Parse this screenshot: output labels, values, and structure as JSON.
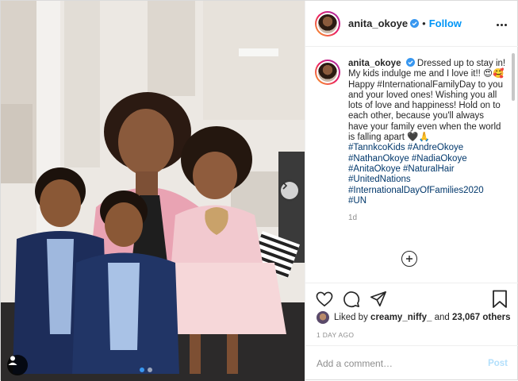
{
  "post": {
    "username": "anita_okoye",
    "follow_label": "Follow",
    "header_separator": "•",
    "caption": {
      "username": "anita_okoye",
      "text": "Dressed up to stay in! My kids indulge me and I love it!! 😍🥰 Happy #InternationalFamilyDay to you and your loved ones! Wishing you all lots of love and happiness! Hold on to each other, because you'll always have your family even when the world is falling apart 🖤🙏",
      "hashtags": [
        "#TannkcoKids #AndreOkoye",
        "#NathanOkoye #NadiaOkoye",
        "#AnitaOkoye #NaturalHair",
        "#UnitedNations",
        "#InternationalDayOfFamilies2020",
        "#UN"
      ],
      "age": "1d"
    },
    "likes": {
      "prefix": "Liked by",
      "user": "creamy_niffy_",
      "middle": "and",
      "count": "23,067 others"
    },
    "timestamp": "1 DAY AGO",
    "comment_placeholder": "Add a comment…",
    "post_label": "Post"
  },
  "carousel": {
    "slides": 2,
    "active": 0
  },
  "icons": {
    "verified": "verified-badge-icon",
    "more": "more-options-icon",
    "like": "heart-icon",
    "comment": "comment-bubble-icon",
    "share": "paper-plane-icon",
    "save": "bookmark-icon",
    "load_more": "plus-circle-icon",
    "next": "chevron-right-icon",
    "tag": "user-tag-icon"
  },
  "colors": {
    "accent": "#0095f6",
    "hashtag": "#00376b",
    "muted": "#8e8e8e",
    "border": "#efefef",
    "verified": "#3897f0"
  }
}
